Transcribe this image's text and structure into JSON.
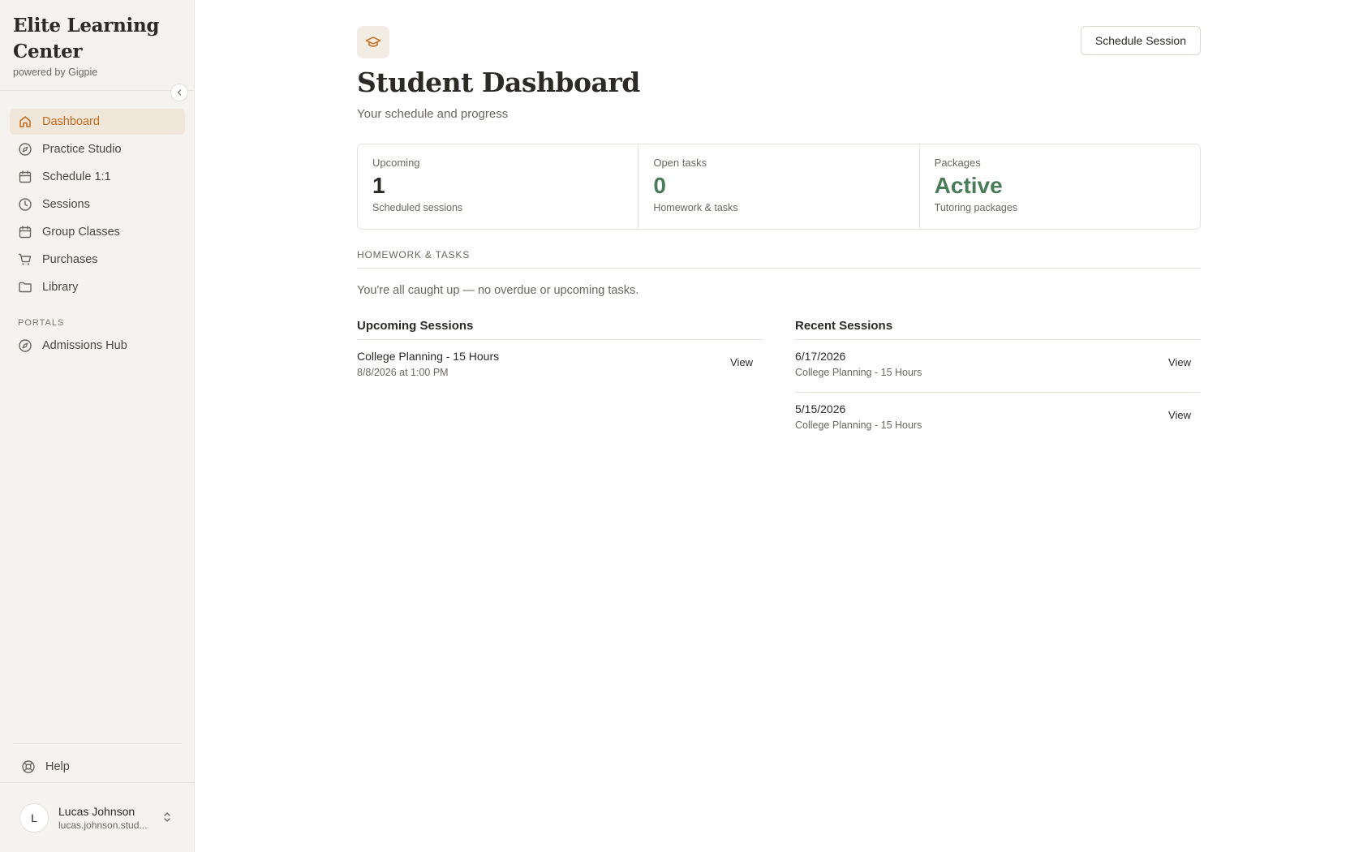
{
  "brand": {
    "title": "Elite Learning Center",
    "subtitle": "powered by Gigpie"
  },
  "sidebar": {
    "items": [
      {
        "label": "Dashboard",
        "icon": "home-icon",
        "active": true
      },
      {
        "label": "Practice Studio",
        "icon": "compass-icon"
      },
      {
        "label": "Schedule 1:1",
        "icon": "calendar-icon"
      },
      {
        "label": "Sessions",
        "icon": "clock-icon"
      },
      {
        "label": "Group Classes",
        "icon": "calendar-icon"
      },
      {
        "label": "Purchases",
        "icon": "cart-icon"
      },
      {
        "label": "Library",
        "icon": "folder-icon"
      }
    ],
    "portals_label": "PORTALS",
    "portals": [
      {
        "label": "Admissions Hub",
        "icon": "compass-icon"
      }
    ],
    "help_label": "Help"
  },
  "user": {
    "initial": "L",
    "name": "Lucas Johnson",
    "email": "lucas.johnson.stud..."
  },
  "header": {
    "title": "Student Dashboard",
    "subtitle": "Your schedule and progress",
    "schedule_button": "Schedule Session"
  },
  "stats": [
    {
      "label": "Upcoming",
      "value": "1",
      "desc": "Scheduled sessions"
    },
    {
      "label": "Open tasks",
      "value": "0",
      "desc": "Homework & tasks"
    },
    {
      "label": "Packages",
      "value": "Active",
      "desc": "Tutoring packages"
    }
  ],
  "homework": {
    "label": "HOMEWORK & TASKS",
    "empty_text": "You're all caught up — no overdue or upcoming tasks."
  },
  "upcoming": {
    "title": "Upcoming Sessions",
    "rows": [
      {
        "title": "College Planning - 15 Hours",
        "sub": "8/8/2026 at 1:00 PM",
        "action": "View"
      }
    ]
  },
  "recent": {
    "title": "Recent Sessions",
    "rows": [
      {
        "title": "6/17/2026",
        "sub": "College Planning - 15 Hours",
        "action": "View"
      },
      {
        "title": "5/15/2026",
        "sub": "College Planning - 15 Hours",
        "action": "View"
      }
    ]
  },
  "colors": {
    "accent": "#c8691b",
    "active_bg": "#f0e6d9",
    "green": "#4a7c59",
    "sidebar_bg": "#f5f3ef"
  }
}
